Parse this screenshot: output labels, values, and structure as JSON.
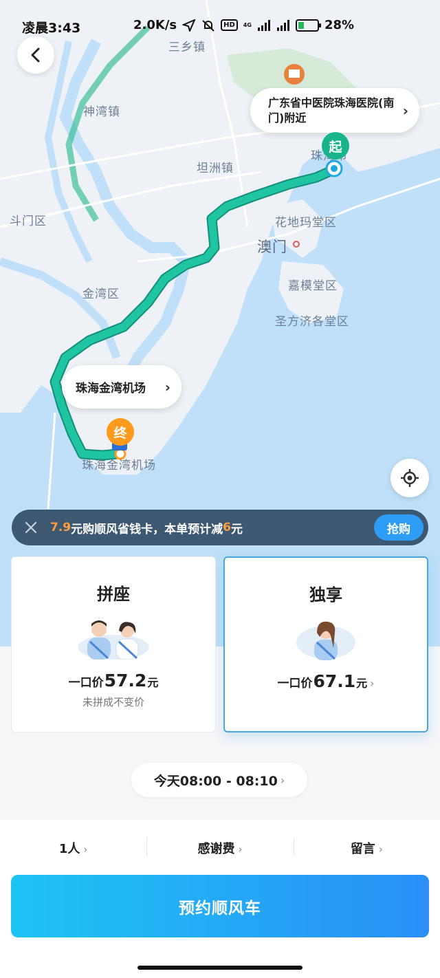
{
  "status_bar": {
    "time": "凌晨3:43",
    "speed": "2.0K/s",
    "network": "4G",
    "hd": "HD",
    "battery": "28%"
  },
  "map": {
    "labels": [
      "三乡镇",
      "神湾镇",
      "坦洲镇",
      "斗门区",
      "金湾区",
      "花地玛堂区",
      "澳门",
      "嘉模堂区",
      "圣方济各堂区",
      "珠海市",
      "珠海金湾机场"
    ],
    "start_callout": "广东省中医院珠海医院(南门)附近",
    "end_callout": "珠海金湾机场",
    "start_pin": "起",
    "end_pin": "终",
    "colors": {
      "route": "#1bbc9b",
      "sea": "#bfe0f8",
      "land": "#eef2f6"
    }
  },
  "promo": {
    "price": "7.9",
    "text_a": "元购顺风省钱卡，本单预计减",
    "discount": "6",
    "text_b": "元",
    "buy_label": "抢购"
  },
  "options": [
    {
      "title": "拼座",
      "price_prefix": "一口价",
      "price": "57.2",
      "unit": "元",
      "note": "未拼成不变价"
    },
    {
      "title": "独享",
      "price_prefix": "一口价",
      "price": "67.1",
      "unit": "元",
      "note": ""
    }
  ],
  "time_selector": "今天08:00 - 08:10",
  "bottom_options": {
    "passengers": "1人",
    "thanks_fee": "感谢费",
    "message": "留言"
  },
  "submit_label": "预约顺风车"
}
